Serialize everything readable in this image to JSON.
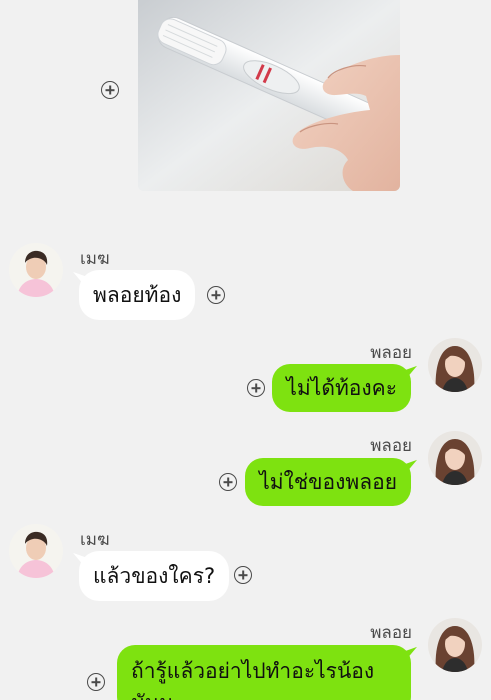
{
  "chat": {
    "messages": [
      {
        "type": "image",
        "content": "pregnancy-test-photo"
      },
      {
        "sender": "เมฆ",
        "text": "พลอยท้อง",
        "direction": "incoming"
      },
      {
        "sender": "พลอย",
        "text": "ไม่ได้ท้องคะ",
        "direction": "outgoing"
      },
      {
        "sender": "พลอย",
        "text": "ไม่ใช่ของพลอย",
        "direction": "outgoing"
      },
      {
        "sender": "เมฆ",
        "text": "แล้วของใคร?",
        "direction": "incoming"
      },
      {
        "sender": "พลอย",
        "text": "ถ้ารู้แล้วอย่าไปทำอะไรน้องมันนะ",
        "direction": "outgoing"
      }
    ]
  },
  "colors": {
    "background": "#f1f1f1",
    "outgoing_bubble": "#7ee210",
    "incoming_bubble": "#ffffff"
  },
  "icons": {
    "reaction": "add-circle-icon"
  }
}
